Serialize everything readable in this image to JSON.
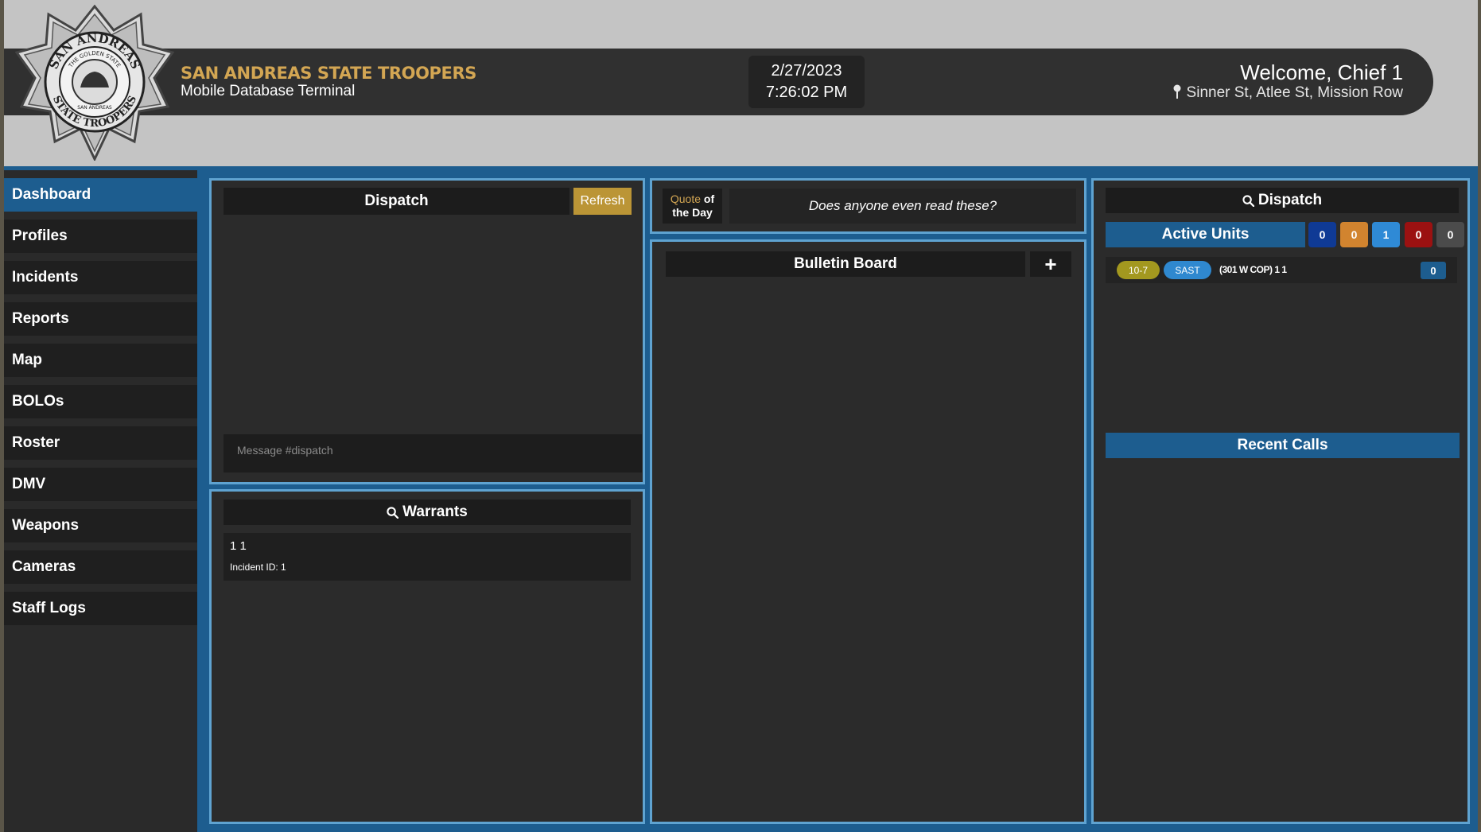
{
  "header": {
    "org_name": "SAN ANDREAS STATE TROOPERS",
    "org_subtitle": "Mobile Database Terminal",
    "date": "2/27/2023",
    "time": "7:26:02 PM",
    "welcome": "Welcome, Chief 1",
    "location": "Sinner St, Atlee St, Mission Row",
    "badge": {
      "top_text": "SAN ANDREAS",
      "bottom_text": "STATE TROOPERS",
      "ring_top": "THE GOLDEN STATE",
      "ring_bottom": "SAN ANDREAS"
    }
  },
  "sidebar": {
    "items": [
      {
        "label": "Dashboard",
        "active": true
      },
      {
        "label": "Profiles"
      },
      {
        "label": "Incidents"
      },
      {
        "label": "Reports"
      },
      {
        "label": "Map"
      },
      {
        "label": "BOLOs"
      },
      {
        "label": "Roster"
      },
      {
        "label": "DMV"
      },
      {
        "label": "Weapons"
      },
      {
        "label": "Cameras"
      },
      {
        "label": "Staff Logs"
      }
    ]
  },
  "dispatch": {
    "title": "Dispatch",
    "refresh_label": "Refresh",
    "message_placeholder": "Message #dispatch"
  },
  "warrants": {
    "title": "Warrants",
    "items": [
      {
        "name": "1 1",
        "incident": "Incident ID: 1"
      }
    ]
  },
  "quote": {
    "label_highlight": "Quote",
    "label_rest_1": " of",
    "label_rest_2": "the Day",
    "text": "Does anyone even read these?"
  },
  "bulletin": {
    "title": "Bulletin Board",
    "add_label": "+"
  },
  "dispatch_units": {
    "title": "Dispatch",
    "active_units_label": "Active Units",
    "counts": [
      {
        "value": "0",
        "color": "#0f3a95"
      },
      {
        "value": "0",
        "color": "#d2842f"
      },
      {
        "value": "1",
        "color": "#2f8ad6"
      },
      {
        "value": "0",
        "color": "#9b1111"
      },
      {
        "value": "0",
        "color": "#4b4b4b"
      }
    ],
    "units": [
      {
        "status": "10-7",
        "status_color": "#a3981f",
        "dept": "SAST",
        "dept_color": "#2f88cf",
        "callsign": "(301 W COP) 1 1",
        "count": "0"
      }
    ],
    "recent_calls_label": "Recent Calls"
  },
  "colors": {
    "accent_blue": "#1d5d8f",
    "panel_border": "#5fa3d1",
    "gold": "#d3a653"
  }
}
